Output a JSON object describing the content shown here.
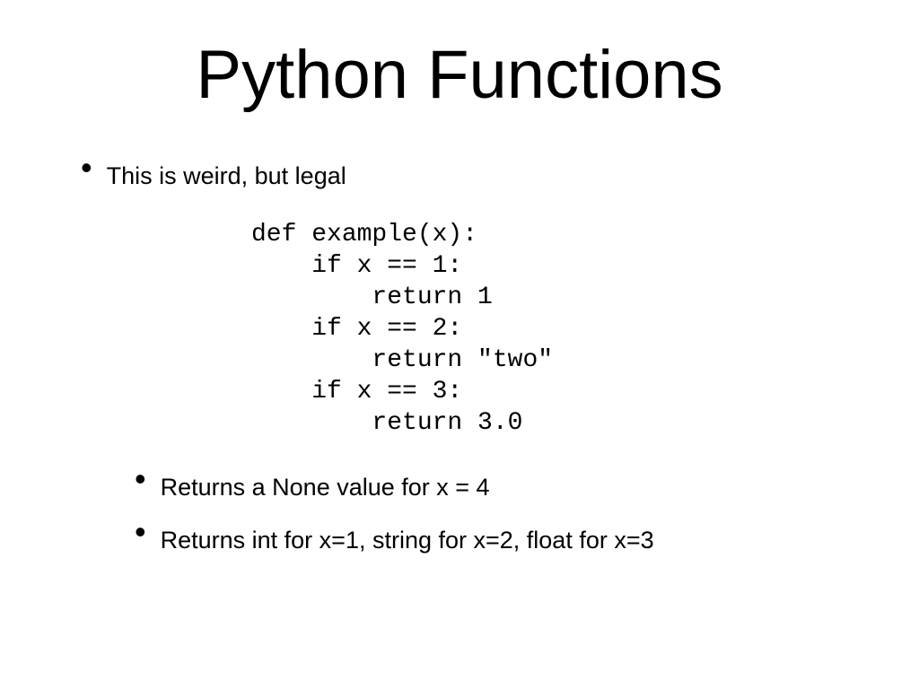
{
  "title": "Python Functions",
  "bullets": {
    "main": "This is weird, but legal",
    "sub1": "Returns a None value for x = 4",
    "sub2": "Returns int for x=1, string for x=2, float for x=3"
  },
  "code": {
    "l1": "def example(x):",
    "l2": "    if x == 1:",
    "l3": "        return 1",
    "l4": "    if x == 2:",
    "l5": "        return \"two\"",
    "l6": "    if x == 3:",
    "l7": "        return 3.0"
  }
}
